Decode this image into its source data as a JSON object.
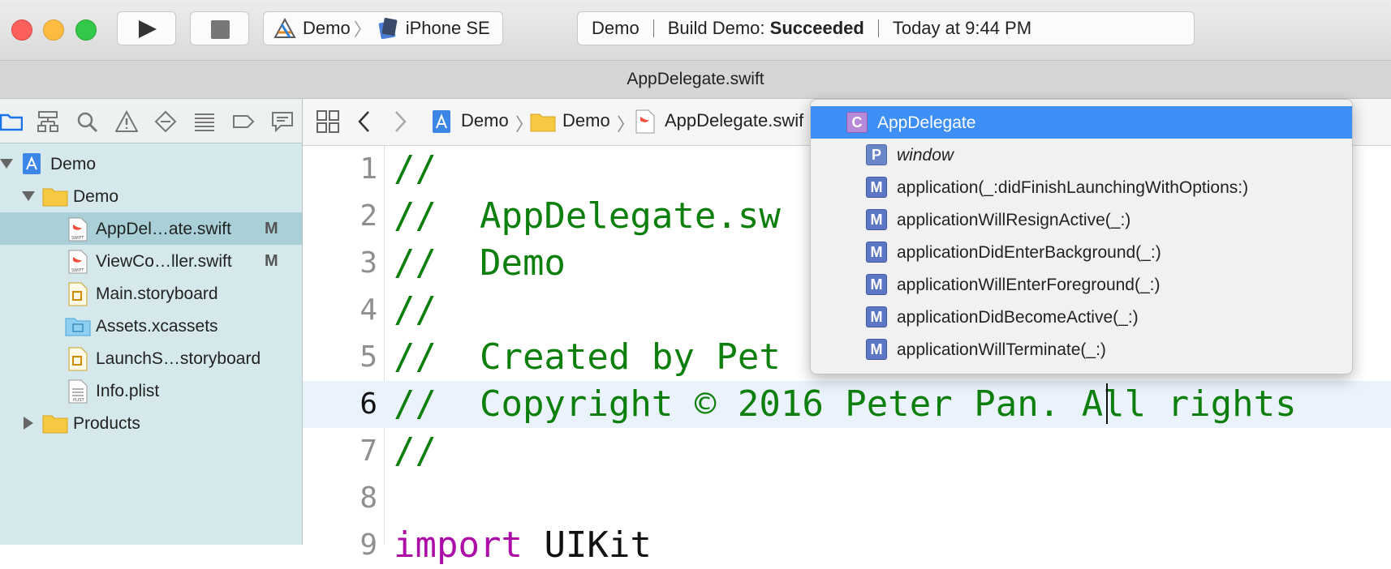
{
  "toolbar": {
    "run_icon": "play-icon",
    "stop_icon": "stop-icon",
    "scheme": "Demo",
    "device": "iPhone SE",
    "activity": {
      "project": "Demo",
      "build_prefix": "Build Demo:",
      "build_status": "Succeeded",
      "timestamp": "Today at 9:44 PM"
    }
  },
  "tab": {
    "title": "AppDelegate.swift"
  },
  "navigator": {
    "icons": [
      "folder-icon",
      "hierarchy-icon",
      "search-icon",
      "warning-icon",
      "test-icon",
      "debug-icon",
      "breakpoint-icon",
      "report-icon"
    ],
    "tree": [
      {
        "label": "Demo",
        "badge": ""
      },
      {
        "label": "Demo",
        "badge": ""
      },
      {
        "label": "AppDel…ate.swift",
        "badge": "M"
      },
      {
        "label": "ViewCo…ller.swift",
        "badge": "M"
      },
      {
        "label": "Main.storyboard",
        "badge": ""
      },
      {
        "label": "Assets.xcassets",
        "badge": ""
      },
      {
        "label": "LaunchS…storyboard",
        "badge": ""
      },
      {
        "label": "Info.plist",
        "badge": ""
      },
      {
        "label": "Products",
        "badge": ""
      }
    ]
  },
  "jumpbar": {
    "crumbs": [
      "Demo",
      "Demo",
      "AppDelegate.swif"
    ]
  },
  "editor": {
    "lines": [
      {
        "num": "1",
        "code": "//"
      },
      {
        "num": "2",
        "code": "//  AppDelegate.sw"
      },
      {
        "num": "3",
        "code": "//  Demo"
      },
      {
        "num": "4",
        "code": "//"
      },
      {
        "num": "5",
        "code": "//  Created by Pet"
      },
      {
        "num": "6",
        "code": "//  Copyright © 2016 Peter Pan. All rights"
      },
      {
        "num": "7",
        "code": "//"
      },
      {
        "num": "8",
        "code": ""
      },
      {
        "num": "9",
        "kw": "import",
        "rest": " UIKit"
      }
    ]
  },
  "popup": {
    "items": [
      {
        "symbol": "C",
        "label": "AppDelegate"
      },
      {
        "symbol": "P",
        "label": "window"
      },
      {
        "symbol": "M",
        "label": "application(_:didFinishLaunchingWithOptions:)"
      },
      {
        "symbol": "M",
        "label": "applicationWillResignActive(_:)"
      },
      {
        "symbol": "M",
        "label": "applicationDidEnterBackground(_:)"
      },
      {
        "symbol": "M",
        "label": "applicationWillEnterForeground(_:)"
      },
      {
        "symbol": "M",
        "label": "applicationDidBecomeActive(_:)"
      },
      {
        "symbol": "M",
        "label": "applicationWillTerminate(_:)"
      }
    ]
  },
  "colors": {
    "selection": "#3d8ff5",
    "comment_green": "#0d7f0d",
    "keyword": "#ad0da7",
    "navigator_bg": "#d5e9ec"
  }
}
